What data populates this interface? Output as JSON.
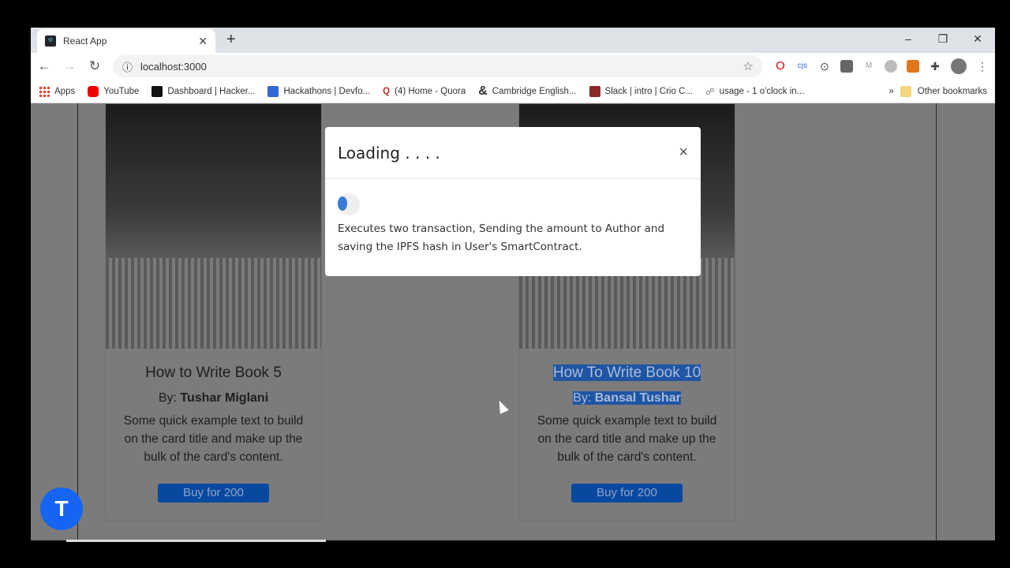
{
  "browser": {
    "tab_title": "React App",
    "url": "localhost:3000",
    "bookmarks": [
      {
        "label": "Apps",
        "color": "#e94235"
      },
      {
        "label": "YouTube",
        "color": "#e00"
      },
      {
        "label": "Dashboard | Hacker...",
        "color": "#111"
      },
      {
        "label": "Hackathons | Devfo...",
        "color": "#3367d6"
      },
      {
        "label": "(4) Home - Quora",
        "color": "#b92b27"
      },
      {
        "label": "Cambridge English...",
        "color": "#000"
      },
      {
        "label": "Slack | intro | Crio C...",
        "color": "#8a2a2a"
      },
      {
        "label": "usage - 1 o'clock in...",
        "color": "#888"
      }
    ],
    "other_bookmarks": "Other bookmarks"
  },
  "cards": [
    {
      "title": "How to Write Book 5",
      "by_label": "By:",
      "author": "Tushar Miglani",
      "text": "Some quick example text to build on the card title and make up the bulk of the card's content.",
      "button": "Buy for 200"
    },
    {
      "title": "How To Write Book 10",
      "by_label": "By:",
      "author": "Bansal Tushar",
      "text": "Some quick example text to build on the card title and make up the bulk of the card's content.",
      "button": "Buy for 200"
    }
  ],
  "modal": {
    "title": "Loading . . . .",
    "close": "×",
    "message": "Executes two transaction, Sending the amount to Author and saving the IPFS hash in User's SmartContract."
  },
  "fab_label": "T"
}
